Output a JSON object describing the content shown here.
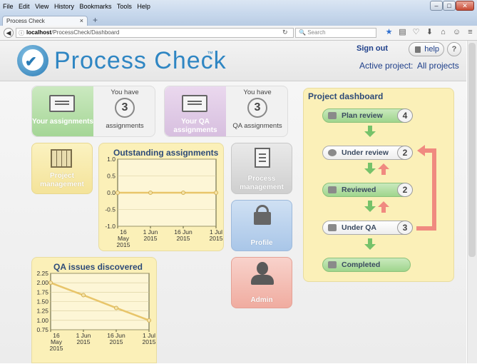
{
  "browser": {
    "menu": [
      "File",
      "Edit",
      "View",
      "History",
      "Bookmarks",
      "Tools",
      "Help"
    ],
    "tab_title": "Process Check",
    "tab_close": "×",
    "new_tab": "+",
    "url_host": "localhost",
    "url_path": "/ProcessCheck/Dashboard",
    "search_placeholder": "Search",
    "window_buttons": [
      "–",
      "□",
      "✕"
    ]
  },
  "header": {
    "brand": "Process Check",
    "tm": "™",
    "sign_out": "Sign out",
    "help": "help",
    "question": "?",
    "active_project_label": "Active project:",
    "active_project_value": "All projects"
  },
  "tiles": {
    "assignments": {
      "you_have": "You have",
      "count": "3",
      "label": "Your assignments",
      "sub": "assignments"
    },
    "qa_assignments": {
      "you_have": "You have",
      "count": "3",
      "label": "Your QA assignments",
      "sub": "QA assignments"
    },
    "project_management": {
      "label": "Project management"
    },
    "process_management": {
      "label": "Process management"
    },
    "profile": {
      "label": "Profile"
    },
    "admin": {
      "label": "Admin"
    }
  },
  "chart_data": [
    {
      "type": "line",
      "title": "Outstanding assignments",
      "x": [
        "16 May 2015",
        "1 Jun 2015",
        "16 Jun 2015",
        "1 Jul 2015"
      ],
      "xticks": [
        [
          "16",
          "May",
          "2015"
        ],
        [
          "1 Jun",
          "2015"
        ],
        [
          "16 Jun",
          "2015"
        ],
        [
          "1 Jul",
          "2015"
        ]
      ],
      "yticks": [
        "1.0",
        "0.5",
        "0.0",
        "-0.5",
        "-1.0"
      ],
      "ylim": [
        -1.0,
        1.0
      ],
      "series": [
        {
          "values": [
            0,
            0,
            0,
            0
          ]
        }
      ]
    },
    {
      "type": "line",
      "title": "QA issues discovered",
      "x": [
        "16 May 2015",
        "1 Jun 2015",
        "16 Jun 2015",
        "1 Jul 2015"
      ],
      "xticks": [
        [
          "16",
          "May",
          "2015"
        ],
        [
          "1 Jun",
          "2015"
        ],
        [
          "16 Jun",
          "2015"
        ],
        [
          "1 Jul",
          "2015"
        ]
      ],
      "yticks": [
        "2.25",
        "2.00",
        "1.75",
        "1.50",
        "1.25",
        "1.00",
        "0.75"
      ],
      "ylim": [
        0.75,
        2.25
      ],
      "series": [
        {
          "values": [
            2.0,
            1.67,
            1.33,
            1.0
          ]
        }
      ]
    }
  ],
  "dashboard": {
    "title": "Project dashboard",
    "stages": [
      {
        "label": "Plan review",
        "count": "4"
      },
      {
        "label": "Under review",
        "count": "2"
      },
      {
        "label": "Reviewed",
        "count": "2"
      },
      {
        "label": "Under QA",
        "count": "3"
      },
      {
        "label": "Completed",
        "count": ""
      }
    ],
    "colors": {
      "forward": "#76c26a",
      "back": "#f08a80"
    }
  }
}
